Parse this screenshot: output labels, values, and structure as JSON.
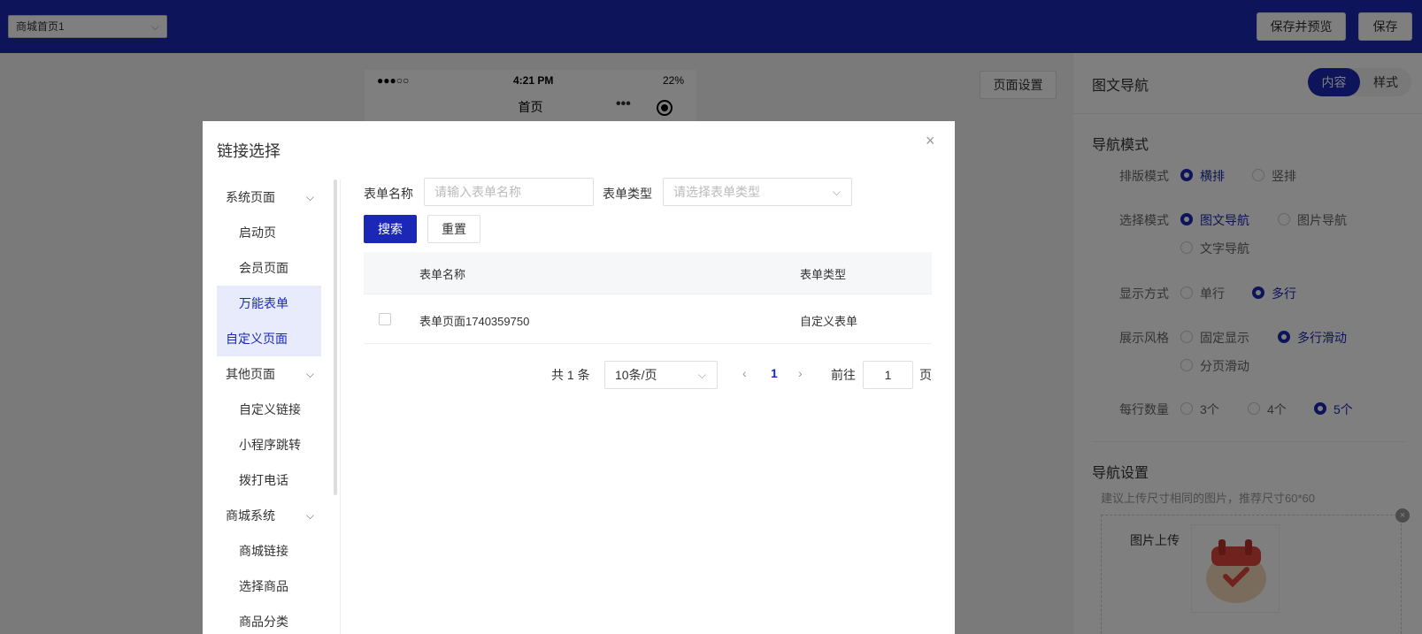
{
  "topbar": {
    "page_select": "商城首页1",
    "save_preview_label": "保存并预览",
    "save_label": "保存"
  },
  "phone": {
    "signal": "●●●○○",
    "time": "4:21 PM",
    "battery": "22%",
    "title": "首页",
    "dots": "•••"
  },
  "canvas": {
    "page_settings_label": "页面设置"
  },
  "right_panel": {
    "title": "图文导航",
    "tabs": [
      "内容",
      "样式"
    ],
    "nav_mode_title": "导航模式",
    "layout_mode": {
      "label": "排版模式",
      "options": [
        "横排",
        "竖排"
      ],
      "selected": "横排"
    },
    "select_mode": {
      "label": "选择模式",
      "options": [
        "图文导航",
        "图片导航",
        "文字导航"
      ],
      "selected": "图文导航"
    },
    "display_mode": {
      "label": "显示方式",
      "options": [
        "单行",
        "多行"
      ],
      "selected": "多行"
    },
    "show_style": {
      "label": "展示风格",
      "options": [
        "固定显示",
        "多行滑动",
        "分页滑动"
      ],
      "selected": "多行滑动"
    },
    "per_row": {
      "label": "每行数量",
      "options": [
        "3个",
        "4个",
        "5个"
      ],
      "selected": "5个"
    },
    "nav_settings_title": "导航设置",
    "hint": "建议上传尺寸相同的图片，推荐尺寸60*60",
    "upload_label": "图片上传"
  },
  "dialog": {
    "title": "链接选择",
    "close": "×",
    "nav": [
      {
        "label": "系统页面",
        "type": "group"
      },
      {
        "label": "启动页",
        "type": "sub"
      },
      {
        "label": "会员页面",
        "type": "sub"
      },
      {
        "label": "万能表单",
        "type": "sub",
        "active": true
      },
      {
        "label": "自定义页面",
        "type": "group",
        "active": true
      },
      {
        "label": "其他页面",
        "type": "group"
      },
      {
        "label": "自定义链接",
        "type": "sub"
      },
      {
        "label": "小程序跳转",
        "type": "sub"
      },
      {
        "label": "拨打电话",
        "type": "sub"
      },
      {
        "label": "商城系统",
        "type": "group"
      },
      {
        "label": "商城链接",
        "type": "sub"
      },
      {
        "label": "选择商品",
        "type": "sub"
      },
      {
        "label": "商品分类",
        "type": "sub"
      }
    ],
    "filter": {
      "name_label": "表单名称",
      "name_placeholder": "请输入表单名称",
      "type_label": "表单类型",
      "type_placeholder": "请选择表单类型",
      "search_label": "搜索",
      "reset_label": "重置"
    },
    "table": {
      "headers": [
        "表单名称",
        "表单类型"
      ],
      "rows": [
        {
          "name": "表单页面1740359750",
          "type": "自定义表单"
        }
      ]
    },
    "pagination": {
      "total": "共 1 条",
      "page_size": "10条/页",
      "prev": "‹",
      "current": "1",
      "next": "›",
      "goto_label": "前往",
      "goto_value": "1",
      "unit": "页"
    }
  },
  "colors": {
    "primary": "#1a28b5",
    "overlay": "rgba(0,0,0,0.5)"
  }
}
